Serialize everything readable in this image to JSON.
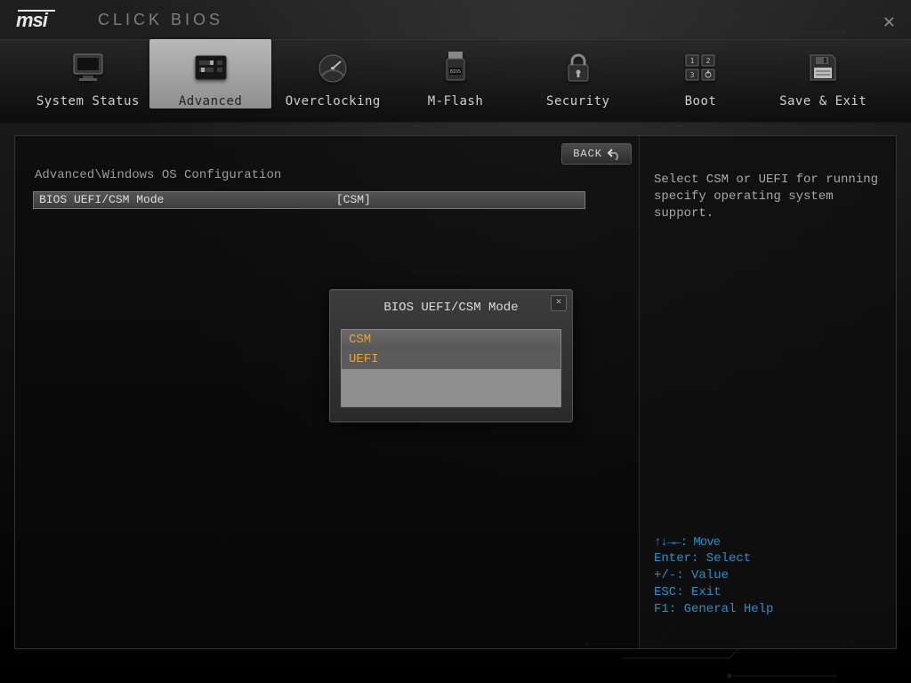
{
  "header": {
    "brand": "msi",
    "title": "CLICK BIOS"
  },
  "tabs": [
    {
      "id": "system-status",
      "label": "System Status"
    },
    {
      "id": "advanced",
      "label": "Advanced",
      "active": true
    },
    {
      "id": "overclocking",
      "label": "Overclocking"
    },
    {
      "id": "m-flash",
      "label": "M-Flash"
    },
    {
      "id": "security",
      "label": "Security"
    },
    {
      "id": "boot",
      "label": "Boot"
    },
    {
      "id": "save-exit",
      "label": "Save & Exit"
    }
  ],
  "back_button": "BACK",
  "breadcrumb": "Advanced\\Windows OS Configuration",
  "setting": {
    "label": "BIOS UEFI/CSM Mode",
    "value": "[CSM]"
  },
  "modal": {
    "title": "BIOS UEFI/CSM Mode",
    "options": [
      {
        "label": "CSM",
        "selected": true
      },
      {
        "label": "UEFI",
        "highlighted": true
      }
    ]
  },
  "help": {
    "text": "Select CSM or UEFI for running specify operating system support."
  },
  "keyhints": {
    "move": "↑↓→←: Move",
    "select": "Enter: Select",
    "value": "+/-: Value",
    "exit": "ESC: Exit",
    "help": "F1: General Help"
  }
}
